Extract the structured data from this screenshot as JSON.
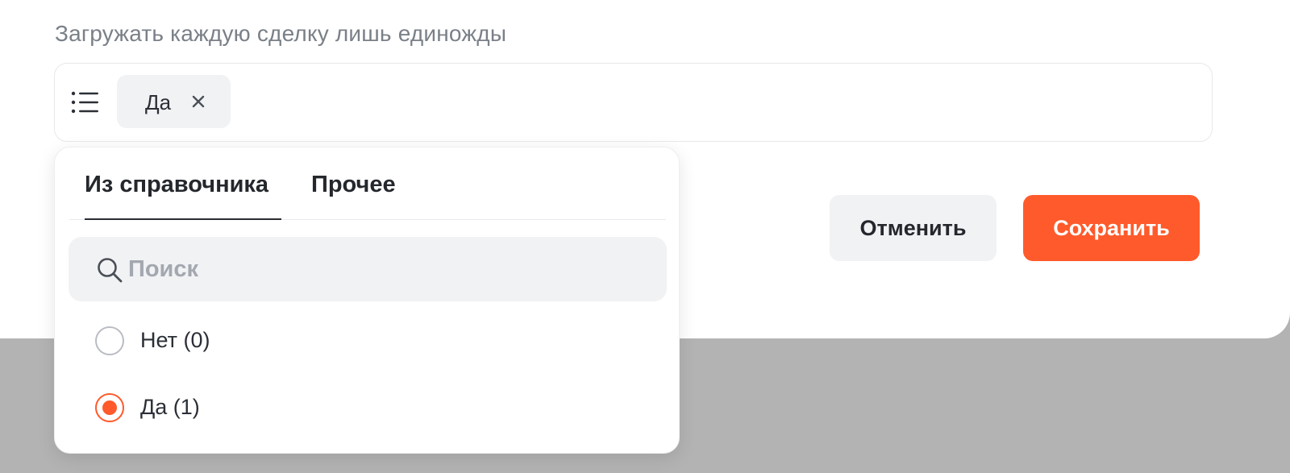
{
  "field": {
    "label": "Загружать каждую сделку лишь единожды",
    "selected_chip": "Да"
  },
  "dropdown": {
    "tabs": [
      {
        "label": "Из справочника",
        "active": true
      },
      {
        "label": "Прочее",
        "active": false
      }
    ],
    "search": {
      "placeholder": "Поиск",
      "value": ""
    },
    "options": [
      {
        "label": "Нет (0)",
        "selected": false
      },
      {
        "label": "Да (1)",
        "selected": true
      }
    ]
  },
  "actions": {
    "cancel_label": "Отменить",
    "save_label": "Сохранить"
  },
  "colors": {
    "accent": "#ff5a2b",
    "overlay": "#b3b3b3",
    "muted_text": "#7a8088"
  },
  "icons": {
    "list": "list-icon",
    "close": "close-icon",
    "search": "search-icon"
  }
}
